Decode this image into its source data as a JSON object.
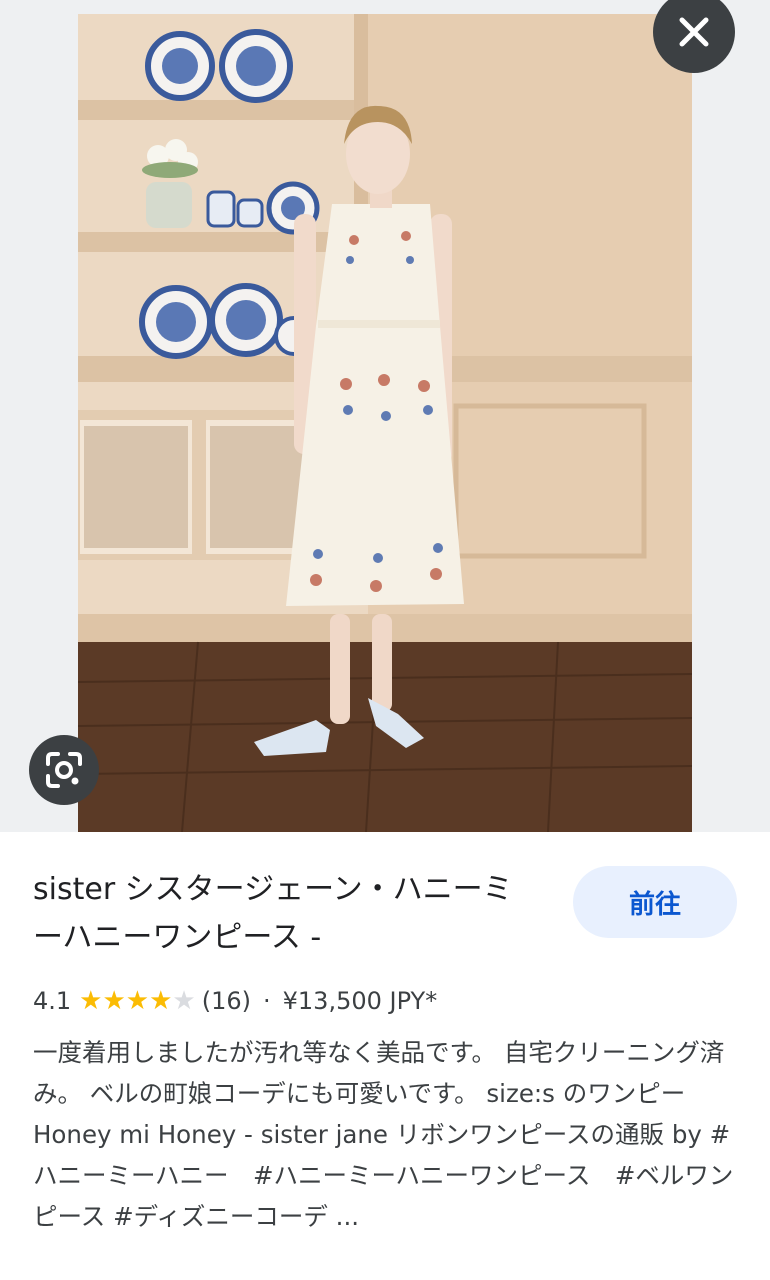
{
  "result": {
    "title": "sister シスタージェーン・ハニーミーハニーワンピース -",
    "visit_label": "前往",
    "rating": "4.1",
    "rating_value": 4.1,
    "review_count": "(16)",
    "separator": "·",
    "price": "¥13,500 JPY*",
    "description": "一度着用しましたが汚れ等なく美品です。 自宅クリーニング済み。 ベルの町娘コーデにも可愛いです。 size:s のワンピー Honey mi Honey - sister jane リボンワンピースの通販 by #ハニーミーハニー　#ハニーミーハニーワンピース　#ベルワンピース #ディズニーコーデ ..."
  },
  "icons": {
    "close": "close-icon",
    "lens": "google-lens-icon",
    "star": "star-icon"
  },
  "colors": {
    "accent": "#0b57d0",
    "button_bg": "#e8f0fe",
    "star": "#fbbc04",
    "overlay_button": "#3c4043"
  }
}
